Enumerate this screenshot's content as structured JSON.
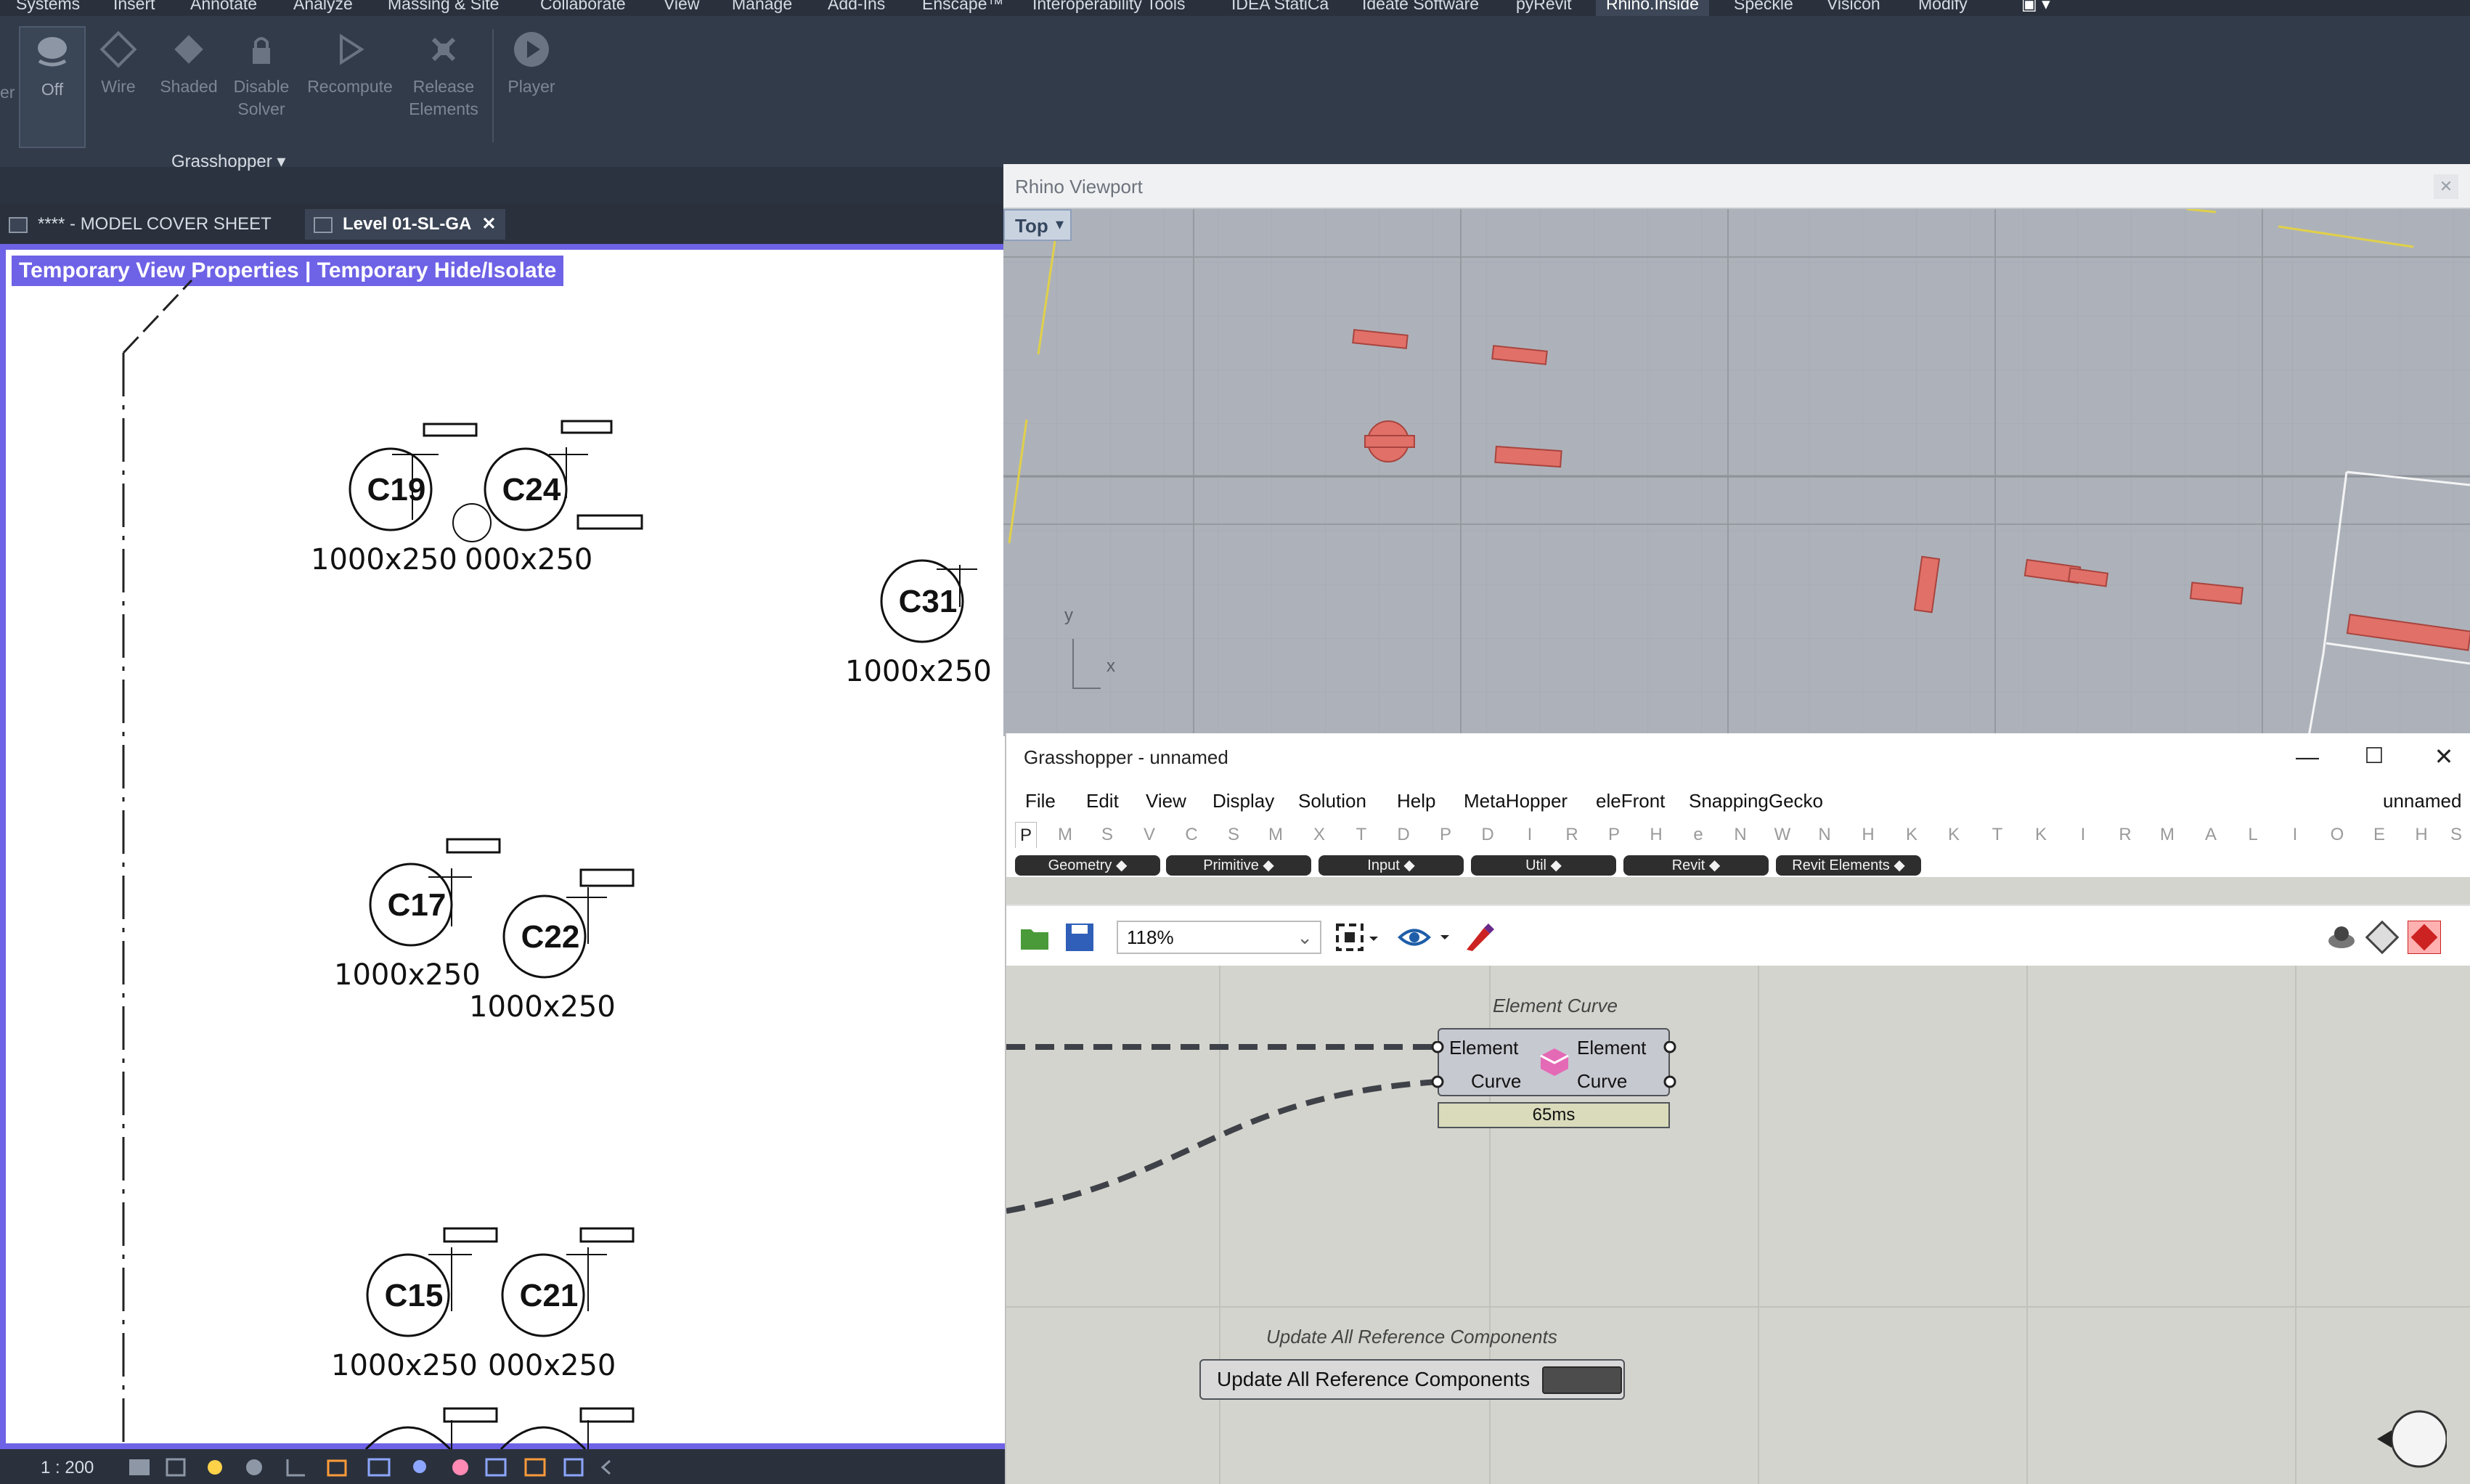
{
  "revit": {
    "menu": [
      "Systems",
      "Insert",
      "Annotate",
      "Analyze",
      "Massing & Site",
      "Collaborate",
      "View",
      "Manage",
      "Add-Ins",
      "Enscape™",
      "Interoperability Tools",
      "IDEA StatiCa",
      "Ideate Software",
      "pyRevit",
      "Rhino.Inside",
      "Speckle",
      "Visicon",
      "Modify"
    ],
    "active_menu": "Rhino.Inside",
    "ribbon": {
      "buttons": [
        {
          "label1": "Off",
          "label2": ""
        },
        {
          "label1": "Wire",
          "label2": ""
        },
        {
          "label1": "Shaded",
          "label2": ""
        },
        {
          "label1": "Disable",
          "label2": "Solver"
        },
        {
          "label1": "Recompute",
          "label2": ""
        },
        {
          "label1": "Release",
          "label2": "Elements"
        },
        {
          "label1": "Player",
          "label2": ""
        }
      ],
      "left_fragment": "er",
      "panel_title": "Grasshopper"
    },
    "tabs": [
      {
        "label": "**** - MODEL COVER SHEET"
      },
      {
        "label": "Level 01-SL-GA"
      }
    ],
    "temp_banner": "Temporary View Properties | Temporary Hide/Isolate",
    "columns": [
      {
        "label": "C19",
        "size": "1000x250"
      },
      {
        "label": "C24",
        "size": "000x250"
      },
      {
        "label": "C31",
        "size": "1000x250"
      },
      {
        "label": "C17",
        "size": "1000x250"
      },
      {
        "label": "C22",
        "size": "1000x250"
      },
      {
        "label": "C15",
        "size": "1000x250"
      },
      {
        "label": "C21",
        "size": "000x250"
      }
    ],
    "scale": "1 : 200"
  },
  "rhino": {
    "title": "Rhino Viewport",
    "view_name": "Top",
    "axis_y": "y",
    "axis_x": "x",
    "object_color": "#e07068"
  },
  "grasshopper": {
    "title": "Grasshopper - unnamed",
    "menu": [
      "File",
      "Edit",
      "View",
      "Display",
      "Solution",
      "Help",
      "MetaHopper",
      "eleFront",
      "SnappingGecko"
    ],
    "doc_name": "unnamed",
    "tab_letters": [
      "P",
      "M",
      "S",
      "V",
      "C",
      "S",
      "M",
      "X",
      "T",
      "D",
      "P",
      "D",
      "I",
      "R",
      "P",
      "H",
      "e",
      "N",
      "W",
      "N",
      "H",
      "K",
      "K",
      "T",
      "K",
      "I",
      "R",
      "M",
      "A",
      "L",
      "I",
      "O",
      "E",
      "H",
      "S"
    ],
    "groups": [
      "Geometry",
      "Primitive",
      "Input",
      "Util",
      "Revit",
      "Revit Elements"
    ],
    "zoom": "118%",
    "components": {
      "element_curve": {
        "title": "Element Curve",
        "in": [
          "Element",
          "Curve"
        ],
        "out": [
          "Element",
          "Curve"
        ],
        "time": "65ms"
      },
      "update_refs": {
        "title": "Update All Reference Components",
        "label": "Update All Reference Components"
      }
    }
  }
}
